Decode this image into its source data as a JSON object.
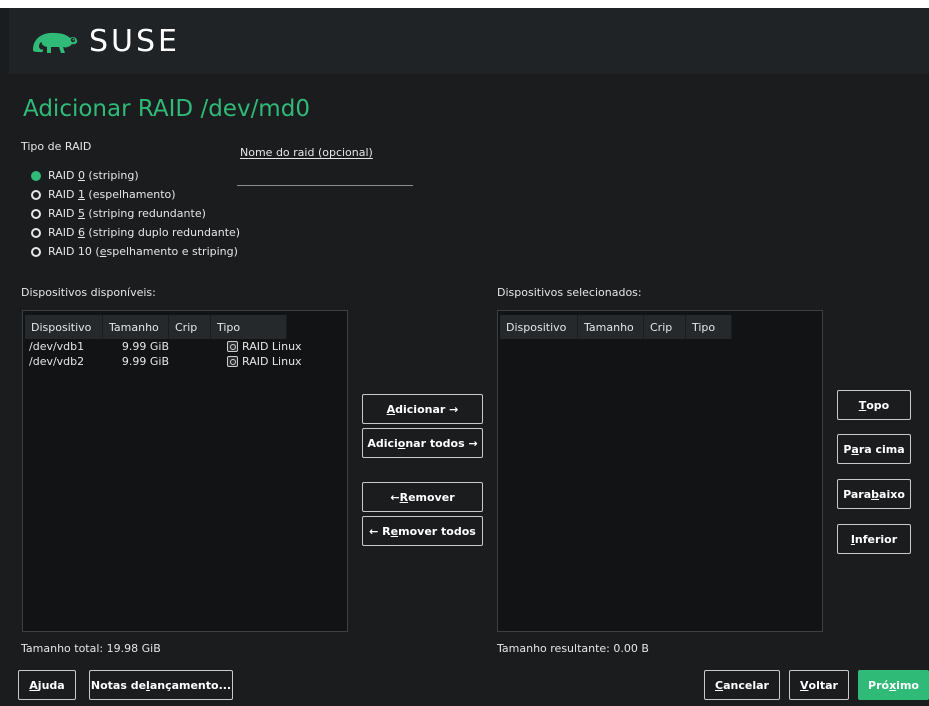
{
  "header": {
    "brand": "SUSE",
    "logo_icon": "suse-chameleon-icon",
    "colors": {
      "brand_green": "#30ba78",
      "header_bg": "#202326",
      "body_bg": "#1a1c1e"
    }
  },
  "page": {
    "title": "Adicionar RAID /dev/md0"
  },
  "raid_type": {
    "label": "Tipo de RAID",
    "options": [
      {
        "pre": "RAID ",
        "key": "0",
        "post": " (striping)",
        "checked": true
      },
      {
        "pre": "RAID ",
        "key": "1",
        "post": " (espelhamento)",
        "checked": false
      },
      {
        "pre": "RAID ",
        "key": "5",
        "post": " (striping redundante)",
        "checked": false
      },
      {
        "pre": "RAID ",
        "key": "6",
        "post": " (striping duplo redundante)",
        "checked": false
      },
      {
        "pre": "RAID 10 (",
        "key": "e",
        "post": "spelhamento e striping)",
        "checked": false
      }
    ]
  },
  "raid_name": {
    "label_key": "N",
    "label_rest": "ome do raid (opcional)",
    "value": ""
  },
  "available": {
    "label": "Dispositivos disponíveis:",
    "columns": [
      "Dispositivo",
      "Tamanho",
      "Crip",
      "Tipo"
    ],
    "rows": [
      {
        "device": "/dev/vdb1",
        "size": "9.99 GiB",
        "crypt": "",
        "type": "RAID Linux"
      },
      {
        "device": "/dev/vdb2",
        "size": "9.99 GiB",
        "crypt": "",
        "type": "RAID Linux"
      }
    ],
    "total": "Tamanho total: 19.98 GiB"
  },
  "selected": {
    "label": "Dispositivos selecionados:",
    "columns": [
      "Dispositivo",
      "Tamanho",
      "Crip",
      "Tipo"
    ],
    "rows": [],
    "total": "Tamanho resultante: 0.00 B"
  },
  "transfer_buttons": {
    "add": {
      "key": "A",
      "rest": "dicionar →"
    },
    "add_all": {
      "pre": "Adici",
      "key": "o",
      "rest": "nar todos →"
    },
    "remove": {
      "pre": "← ",
      "key": "R",
      "rest": "emover"
    },
    "remove_all": {
      "pre": "← R",
      "key": "e",
      "rest": "mover todos"
    }
  },
  "order_buttons": {
    "top": {
      "key": "T",
      "rest": "opo"
    },
    "up": {
      "pre": "P",
      "key": "a",
      "rest": "ra cima"
    },
    "down": {
      "pre": "Para ",
      "key": "b",
      "rest": "aixo"
    },
    "bottom": {
      "key": "I",
      "rest": "nferior"
    }
  },
  "footer": {
    "help": {
      "key": "A",
      "rest": "juda"
    },
    "notes": {
      "pre": "Notas de ",
      "key": "l",
      "rest": "ançamento..."
    },
    "cancel": {
      "key": "C",
      "rest": "ancelar"
    },
    "back": {
      "key": "V",
      "rest": "oltar"
    },
    "next": {
      "pre": "Pró",
      "key": "x",
      "rest": "imo"
    }
  }
}
